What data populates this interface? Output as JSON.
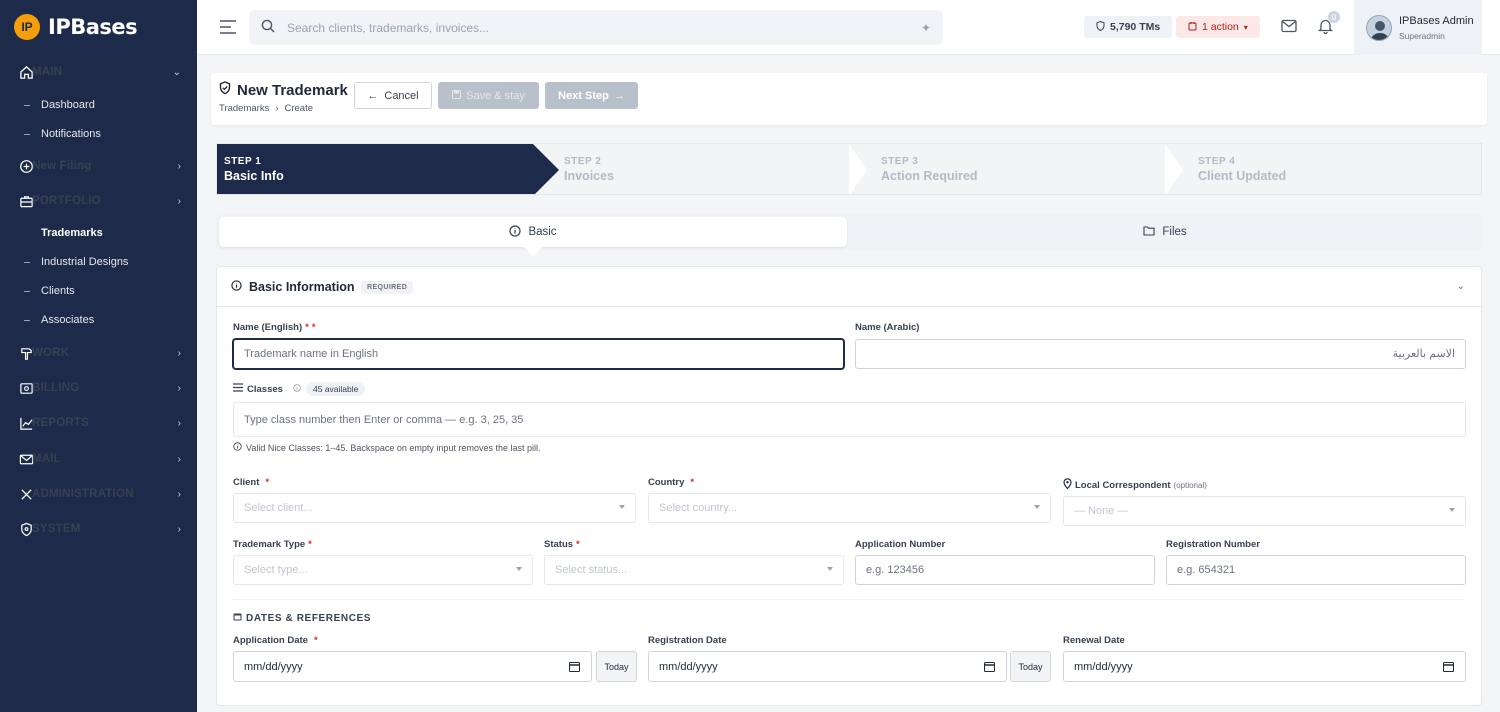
{
  "brand": {
    "logo_text": "IP",
    "name": "IPBases"
  },
  "sidebar": {
    "main_label": "MAIN",
    "items": [
      {
        "label": "Dashboard"
      },
      {
        "label": "Notifications"
      },
      {
        "label": "New Filing"
      },
      {
        "label": "PORTFOLIO"
      },
      {
        "label": "Trademarks"
      },
      {
        "label": "Industrial Designs"
      },
      {
        "label": "Clients"
      },
      {
        "label": "Associates"
      },
      {
        "label": "WORK"
      },
      {
        "label": "BILLING"
      },
      {
        "label": "REPORTS"
      },
      {
        "label": "MAIL"
      },
      {
        "label": "ADMINISTRATION"
      },
      {
        "label": "SYSTEM"
      }
    ]
  },
  "topbar": {
    "search_placeholder": "Search clients, trademarks, invoices...",
    "tms_count": "5,790 TMs",
    "action_label": "1 action",
    "bell_count": "0",
    "user_name": "IPBases Admin",
    "user_role": "Superadmin"
  },
  "header": {
    "title": "New Trademark",
    "breadcrumb": [
      "Trademarks",
      "›",
      "Create"
    ],
    "cancel_label": "Cancel",
    "save_label": "Save & stay",
    "next_label": "Next Step"
  },
  "steps": [
    {
      "num": "STEP 1",
      "name": "Basic Info"
    },
    {
      "num": "STEP 2",
      "name": "Invoices"
    },
    {
      "num": "STEP 3",
      "name": "Action Required"
    },
    {
      "num": "STEP 4",
      "name": "Client Updated"
    }
  ],
  "tabs": [
    {
      "label": "Basic"
    },
    {
      "label": "Files"
    }
  ],
  "section": {
    "title": "Basic Information",
    "badge": "REQUIRED"
  },
  "form": {
    "name_en_label": "Name (English)",
    "name_en_placeholder": "Trademark name in English",
    "name_ar_label": "Name (Arabic)",
    "name_ar_placeholder": "الاسم بالعربية",
    "classes_label": "Classes",
    "classes_available": "45 available",
    "classes_placeholder": "Type class number then Enter or comma — e.g. 3, 25, 35",
    "classes_hint": "Valid Nice Classes: 1–45. Backspace on empty input removes the last pill.",
    "client_label": "Client",
    "client_placeholder": "Select client...",
    "country_label": "Country",
    "country_placeholder": "Select country...",
    "correspondent_label": "Local Correspondent",
    "correspondent_optional": "(optional)",
    "correspondent_value": "— None —",
    "type_label": "Trademark Type",
    "type_placeholder": "Select type...",
    "status_label": "Status",
    "status_placeholder": "Select status...",
    "app_num_label": "Application Number",
    "app_num_placeholder": "e.g. 123456",
    "reg_num_label": "Registration Number",
    "reg_num_placeholder": "e.g. 654321",
    "dates_heading": "DATES & REFERENCES",
    "app_date_label": "Application Date",
    "reg_date_label": "Registration Date",
    "renewal_date_label": "Renewal Date",
    "date_placeholder": "mm/dd/yyyy",
    "today_label": "Today",
    "required_mark": "*"
  },
  "colors": {
    "sidebar_bg": "#1e2a4a",
    "accent": "#1e2a4a",
    "danger": "#dc2626",
    "logo": "#f59e0b"
  }
}
